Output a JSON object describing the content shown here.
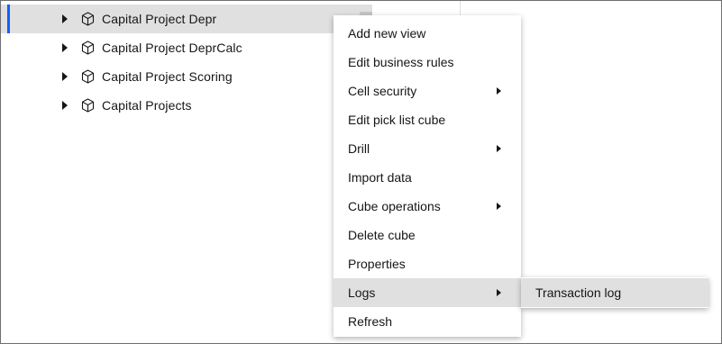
{
  "tree": {
    "items": [
      {
        "label": "Capital Project Depr",
        "icon": "cube-icon",
        "selected": true
      },
      {
        "label": "Capital Project DeprCalc",
        "icon": "cube-icon",
        "selected": false
      },
      {
        "label": "Capital Project Scoring",
        "icon": "cube-icon",
        "selected": false
      },
      {
        "label": "Capital Projects",
        "icon": "cube-icon",
        "selected": false
      }
    ]
  },
  "context_menu": {
    "items": [
      {
        "label": "Add new view",
        "has_submenu": false
      },
      {
        "label": "Edit business rules",
        "has_submenu": false
      },
      {
        "label": "Cell security",
        "has_submenu": true
      },
      {
        "label": "Edit pick list cube",
        "has_submenu": false
      },
      {
        "label": "Drill",
        "has_submenu": true
      },
      {
        "label": "Import data",
        "has_submenu": false
      },
      {
        "label": "Cube operations",
        "has_submenu": true
      },
      {
        "label": "Delete cube",
        "has_submenu": false
      },
      {
        "label": "Properties",
        "has_submenu": false
      },
      {
        "label": "Logs",
        "has_submenu": true,
        "active": true
      },
      {
        "label": "Refresh",
        "has_submenu": false
      }
    ]
  },
  "submenu": {
    "items": [
      {
        "label": "Transaction log"
      }
    ]
  },
  "colors": {
    "selection_indicator": "#0f62fe",
    "highlight": "#e0e0e0",
    "text": "#161616"
  }
}
